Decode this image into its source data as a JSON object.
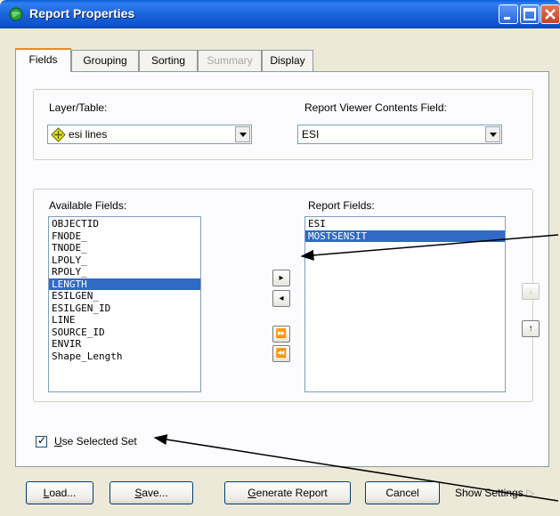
{
  "window": {
    "title": "Report Properties",
    "icon": "globe-icon"
  },
  "tabs": [
    {
      "label": "Fields",
      "active": true
    },
    {
      "label": "Grouping"
    },
    {
      "label": "Sorting"
    },
    {
      "label": "Summary",
      "disabled": true
    },
    {
      "label": "Display"
    }
  ],
  "layer": {
    "label": "Layer/Table:",
    "value": "esi lines",
    "value_icon": "layer-diamond-icon"
  },
  "viewer": {
    "label": "Report Viewer Contents Field:",
    "value": "ESI"
  },
  "available": {
    "label": "Available Fields:",
    "items": [
      "OBJECTID",
      "FNODE_",
      "TNODE_",
      "LPOLY_",
      "RPOLY_",
      "LENGTH",
      "ESILGEN_",
      "ESILGEN_ID",
      "LINE",
      "SOURCE_ID",
      "ENVIR",
      "Shape_Length"
    ],
    "selected_index": 5
  },
  "report": {
    "label": "Report Fields:",
    "items": [
      "ESI",
      "MOSTSENSIT"
    ],
    "selected_index": 1
  },
  "move_buttons": {
    "add": "▸",
    "remove": "◂",
    "add_all": "⏩",
    "remove_all": "⏪"
  },
  "order_buttons": {
    "down": "↓",
    "up": "↑"
  },
  "use_selected_set": {
    "checked": true,
    "label_accel": "U",
    "label_rest": "se Selected Set"
  },
  "buttons": {
    "load_accel": "L",
    "load_rest": "oad...",
    "save_accel": "S",
    "save_rest": "ave...",
    "generate_accel": "G",
    "generate_rest": "enerate Report",
    "cancel": "Cancel",
    "show_settings": "Show Settings",
    "show_settings_arrow": "▷"
  },
  "colors": {
    "titlebar": "#0a5fd6",
    "selection": "#316ac5",
    "window_bg": "#ece9d8"
  }
}
